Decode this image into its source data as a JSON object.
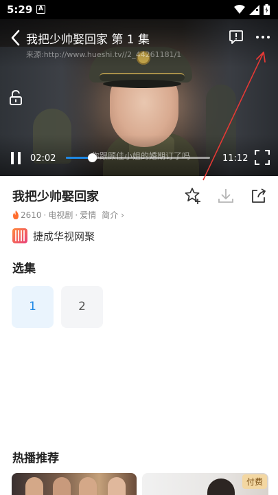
{
  "status_bar": {
    "time": "5:29",
    "notif_letter": "A"
  },
  "player": {
    "title": "我把少帅娶回家  第 1 集",
    "source": "来源:http://www.hueshi.tv//2_44261181/1",
    "subtitle": "你跟顾佳小姐的婚期订了吗",
    "current_time": "02:02",
    "total_time": "11:12",
    "progress_fraction": 0.18
  },
  "info": {
    "title": "我把少帅娶回家",
    "heat": "2610",
    "category": "电视剧",
    "genre": "爱情",
    "intro_label": "简介",
    "provider": "捷成华视网聚"
  },
  "episodes": {
    "title": "选集",
    "items": [
      "1",
      "2"
    ],
    "selected": "1"
  },
  "recommend": {
    "title": "热播推荐",
    "paid_label": "付费"
  },
  "colors": {
    "accent": "#1e88e5",
    "annotation": "#e53935"
  }
}
